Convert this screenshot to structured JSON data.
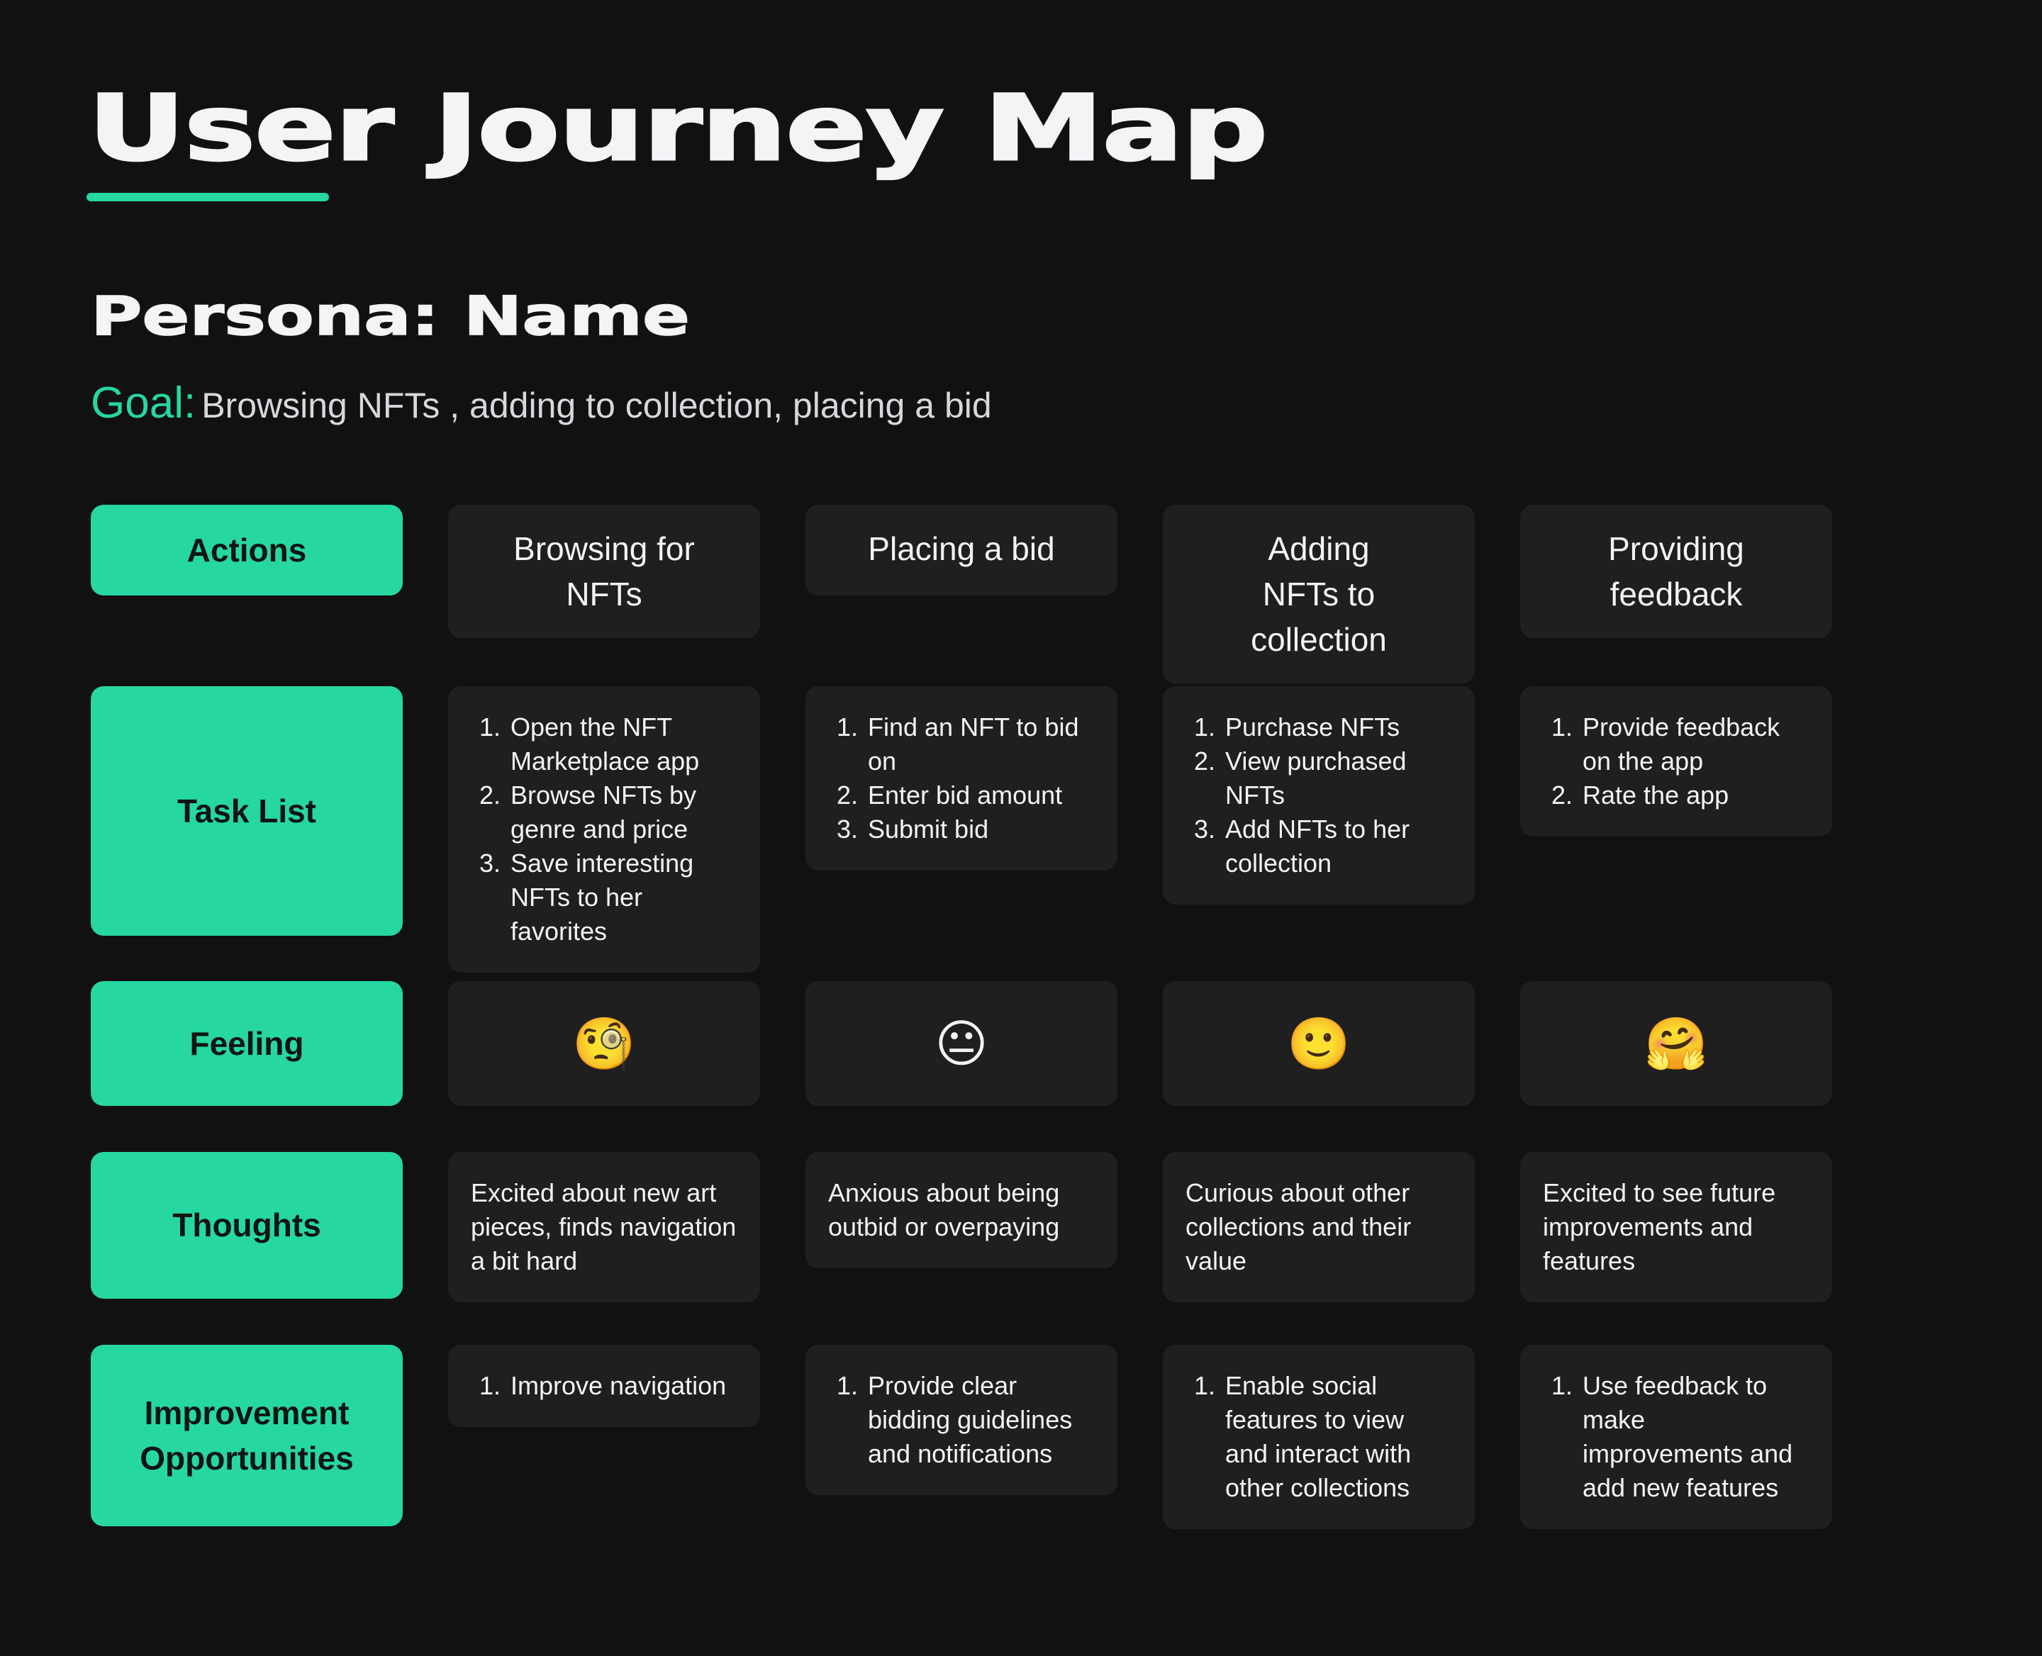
{
  "header": {
    "title": "User Journey Map",
    "persona": "Persona: Name",
    "goal_label": "Goal:",
    "goal_text": "Browsing NFTs , adding to collection, placing a bid"
  },
  "colors": {
    "accent": "#26d7a1",
    "background": "#111111",
    "card": "#1f1f1f",
    "text": "#f3f4f6"
  },
  "rows": {
    "actions": {
      "label": "Actions",
      "cells": [
        "Browsing for NFTs",
        "Placing a bid",
        "Adding NFTs to collection",
        "Providing feedback"
      ]
    },
    "tasks": {
      "label": "Task List",
      "cells": [
        [
          "Open the NFT Marketplace app",
          "Browse NFTs by genre and price",
          "Save interesting NFTs to her favorites"
        ],
        [
          "Find an NFT to bid on",
          "Enter bid amount",
          "Submit bid"
        ],
        [
          "Purchase NFTs",
          "View purchased NFTs",
          "Add NFTs to her collection"
        ],
        [
          "Provide feedback on the app",
          "Rate the app"
        ]
      ]
    },
    "feeling": {
      "label": "Feeling",
      "cells": [
        {
          "emoji": "🧐",
          "icon": "face-with-monocle-icon"
        },
        {
          "emoji": "😐",
          "icon": "neutral-face-icon"
        },
        {
          "emoji": "🙂",
          "icon": "slightly-smiling-face-icon"
        },
        {
          "emoji": "🤗",
          "icon": "hugging-face-icon"
        }
      ]
    },
    "thoughts": {
      "label": "Thoughts",
      "cells": [
        "Excited about new art pieces, finds navigation a bit hard",
        "Anxious about being outbid or overpaying",
        "Curious about other collections and their value",
        "Excited to see future improvements and features"
      ]
    },
    "improvements": {
      "label": "Improvement Opportunities",
      "cells": [
        [
          "Improve navigation"
        ],
        [
          "Provide clear bidding guidelines and notifications"
        ],
        [
          "Enable social features to view and interact with other collections"
        ],
        [
          "Use feedback to make improvements and add new features"
        ]
      ]
    }
  }
}
